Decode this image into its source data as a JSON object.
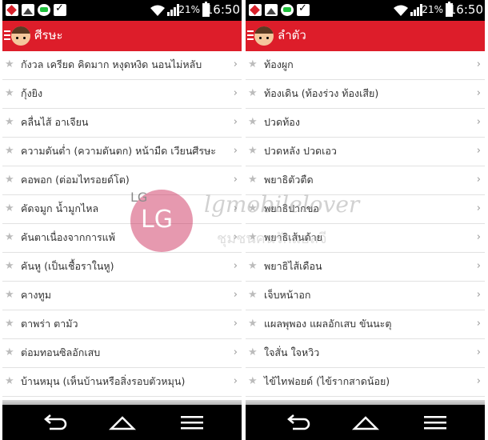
{
  "status_bar": {
    "battery_percent": "21%",
    "time": "16:50"
  },
  "left_screen": {
    "title": "ศีรษะ",
    "items": [
      {
        "label": "กังวล เครียด คิดมาก หงุดหงิด นอนไม่หลับ"
      },
      {
        "label": "กุ้งยิง"
      },
      {
        "label": "คลื่นไส้ อาเจียน"
      },
      {
        "label": "ความดันต่ำ (ความดันตก) หน้ามืด เวียนศีรษะ"
      },
      {
        "label": "คอพอก (ต่อมไทรอยด์โต)"
      },
      {
        "label": "คัดจมูก น้ำมูกไหล"
      },
      {
        "label": "คันตาเนื่องจากการแพ้"
      },
      {
        "label": "คันหู (เป็นเชื้อราในหู)"
      },
      {
        "label": "คางทูม"
      },
      {
        "label": "ตาพร่า ตามัว"
      },
      {
        "label": "ต่อมทอนซิลอักเสบ"
      },
      {
        "label": "บ้านหมุน (เห็นบ้านหรือสิ่งรอบตัวหมุน)"
      }
    ]
  },
  "right_screen": {
    "title": "ลำตัว",
    "items": [
      {
        "label": "ท้องผูก"
      },
      {
        "label": "ท้องเดิน (ท้องร่วง ท้องเสีย)"
      },
      {
        "label": "ปวดท้อง"
      },
      {
        "label": "ปวดหลัง ปวดเอว"
      },
      {
        "label": "พยาธิตัวตืด"
      },
      {
        "label": "พยาธิปากขอ"
      },
      {
        "label": "พยาธิเส้นด้าย"
      },
      {
        "label": "พยาธิไส้เดือน"
      },
      {
        "label": "เจ็บหน้าอก"
      },
      {
        "label": "แผลพุพอง แผลอักเสบ ขันนะตุ"
      },
      {
        "label": "ใจสั่น ใจหวิว"
      },
      {
        "label": "ไข้ไทฟอยด์ (ไข้รากสาดน้อย)"
      }
    ]
  },
  "watermark": {
    "logo_text": "LG",
    "text": "lgmobilelover",
    "subtext": "ชุมชนคนรักแอลจี"
  },
  "icons": {
    "list_item_icon": "star-icon",
    "row_action_icon": "chevron-right-icon",
    "nav_back": "back-icon",
    "nav_home": "home-icon",
    "nav_menu": "menu-icon"
  },
  "colors": {
    "appbar": "#dd1d2a",
    "status_bar": "#000000",
    "nav_bar": "#000000",
    "star": "#bcbcbc",
    "text": "#333333"
  }
}
